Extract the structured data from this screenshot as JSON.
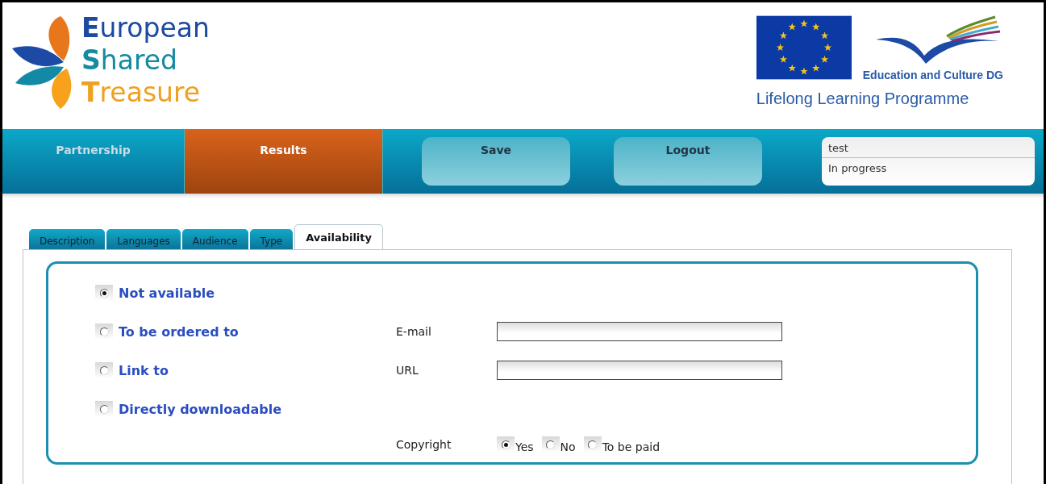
{
  "logo": {
    "lines": [
      "**E**uropean",
      "**S**hared",
      "**T**reasure"
    ],
    "partner_caption": "Education and Culture DG",
    "programme": "Lifelong Learning Programme"
  },
  "nav": {
    "items": [
      {
        "label": "Partnership",
        "selected": false
      },
      {
        "label": "Results",
        "selected": true
      }
    ],
    "buttons": [
      "Save",
      "Logout"
    ],
    "status": {
      "user": "test",
      "state": "In progress"
    }
  },
  "tabs": [
    {
      "label": "Description",
      "selected": false
    },
    {
      "label": "Languages",
      "selected": false
    },
    {
      "label": "Audience",
      "selected": false
    },
    {
      "label": "Type",
      "selected": false
    },
    {
      "label": "Availability",
      "selected": true
    }
  ],
  "availability": {
    "options": [
      {
        "label": "Not available",
        "selected": true
      },
      {
        "label": "To be ordered to",
        "selected": false
      },
      {
        "label": "Link to",
        "selected": false
      },
      {
        "label": "Directly downloadable",
        "selected": false
      }
    ],
    "email": {
      "label": "E-mail"
    },
    "url": {
      "label": "URL"
    },
    "copyright": {
      "label": "Copyright",
      "options": [
        {
          "label": "Yes",
          "selected": true
        },
        {
          "label": "No",
          "selected": false
        },
        {
          "label": "To be paid",
          "selected": false
        }
      ]
    }
  }
}
